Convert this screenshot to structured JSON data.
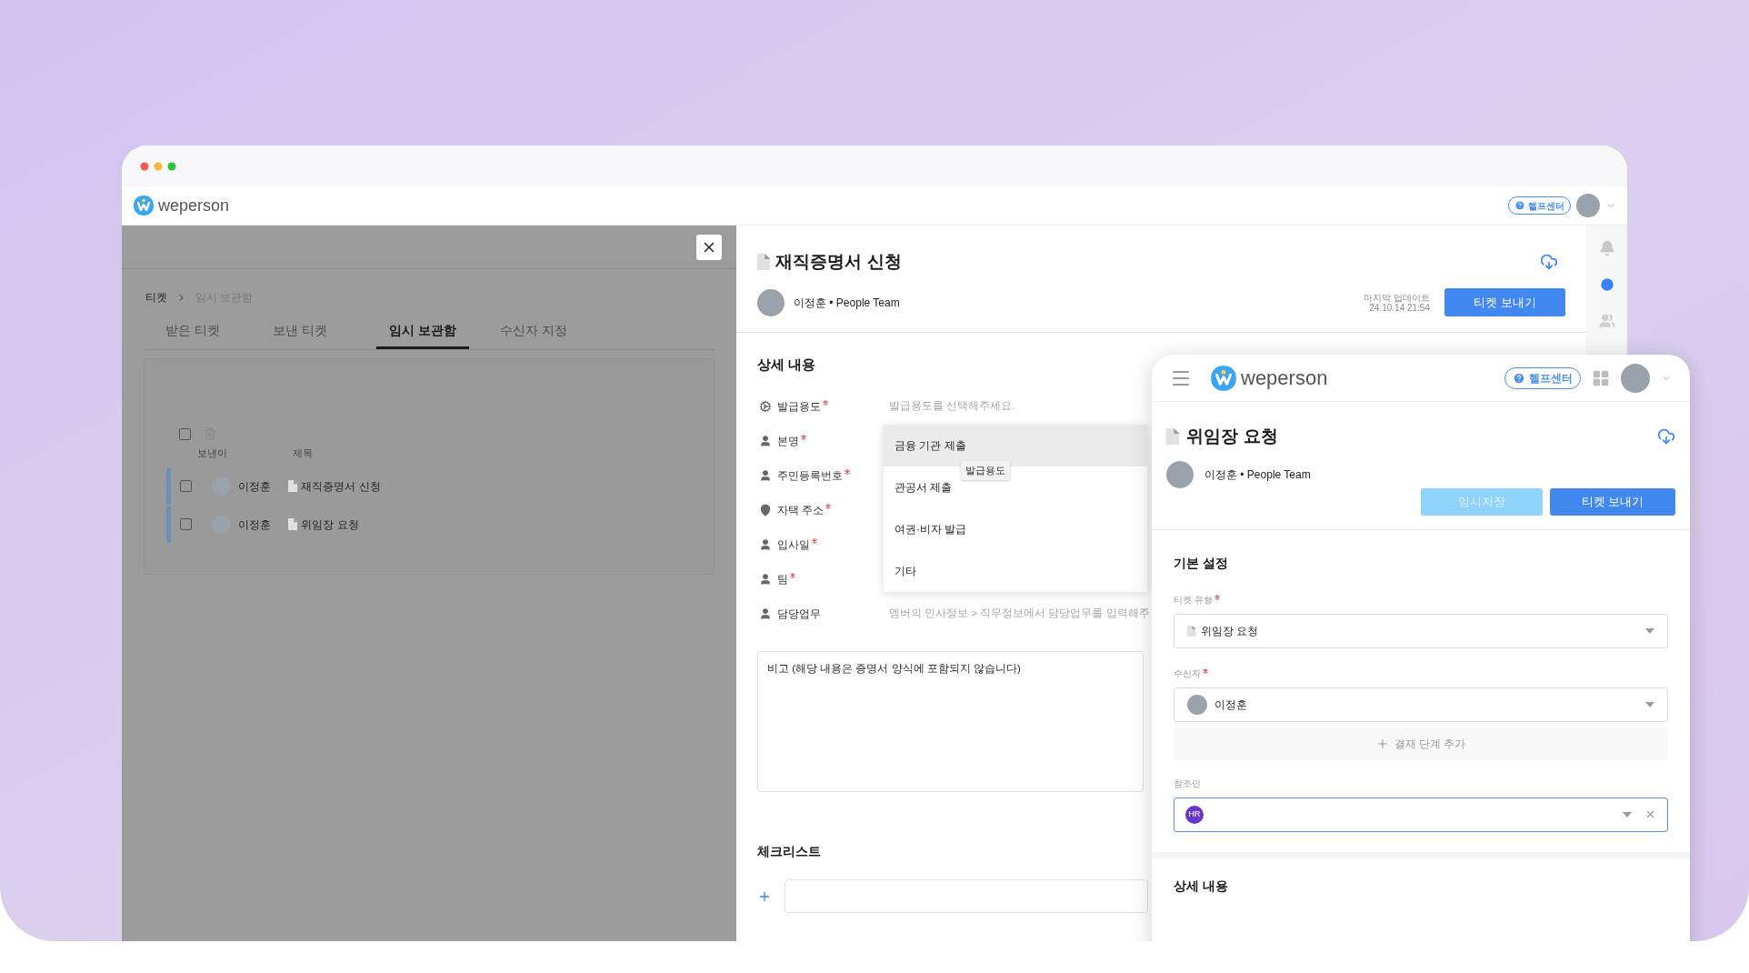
{
  "window": {
    "brand": "weperson",
    "help_button": "헬프센터"
  },
  "left_panel": {
    "breadcrumb": [
      "티켓",
      "임시 보관함"
    ],
    "tabs": [
      {
        "label": "받은 티켓",
        "selected": false
      },
      {
        "label": "보낸 티켓",
        "selected": false
      },
      {
        "label": "임시 보관함",
        "selected": true
      },
      {
        "label": "수신자 지정",
        "selected": false
      }
    ],
    "all_checked": false,
    "columns": [
      "보낸이",
      "제목"
    ],
    "rows": [
      {
        "sender": "이정훈",
        "title": "재직증명서 신청",
        "checked": false
      },
      {
        "sender": "이정훈",
        "title": "위임장 요청",
        "checked": false
      }
    ]
  },
  "ticket": {
    "title": "재직증명서 신청",
    "author": "이정훈 • People Team",
    "updated_label": "마지막 업데이트",
    "updated_time": "24.10.14 21:54",
    "send_button": "티켓 보내기",
    "section": "상세 내용",
    "fields": [
      {
        "kind": "gears",
        "label": "발급용도",
        "required": true,
        "placeholder": "발급용도를 선택해주세요."
      },
      {
        "kind": "person",
        "label": "본명",
        "required": true
      },
      {
        "kind": "person",
        "label": "주민등록번호",
        "required": true
      },
      {
        "kind": "pin",
        "label": "자택 주소",
        "required": true
      },
      {
        "kind": "person",
        "label": "입사일",
        "required": true
      },
      {
        "kind": "person",
        "label": "팀",
        "required": true
      },
      {
        "kind": "person",
        "label": "담당업무",
        "required": false,
        "placeholder": "멤버의 인사정보 > 직무정보에서 담당업무를 입력해주"
      }
    ],
    "dropdown": {
      "options": [
        {
          "label": "금융 기관 제출",
          "selected": true
        },
        {
          "label": "관공서 제출",
          "selected": false
        },
        {
          "label": "여권·비자 발급",
          "selected": false
        },
        {
          "label": "기타",
          "selected": false
        }
      ],
      "tooltip": "발급용도"
    },
    "remarks": {
      "placeholder": "비고 (해당 내용은 증명서 양식에 포함되지 않습니다)"
    },
    "checklist": {
      "title": "체크리스트"
    }
  },
  "mobile": {
    "brand": "weperson",
    "help_button": "헬프센터",
    "title": "위임장 요청",
    "author": "이정훈 • People Team",
    "draft_button": {
      "label": "임시저장",
      "disabled": true
    },
    "send_button": "티켓 보내기",
    "section": "기본 설정",
    "ticket_type": {
      "label": "티켓 유형",
      "required": true,
      "value": "위임장 요청"
    },
    "recipient": {
      "label": "수신자",
      "required": true,
      "value": "이정훈"
    },
    "add_step": "결재 단계 추가",
    "cc": {
      "label": "참조인",
      "tag": "HR",
      "focused": true
    },
    "detail_section": "상세 내용"
  }
}
